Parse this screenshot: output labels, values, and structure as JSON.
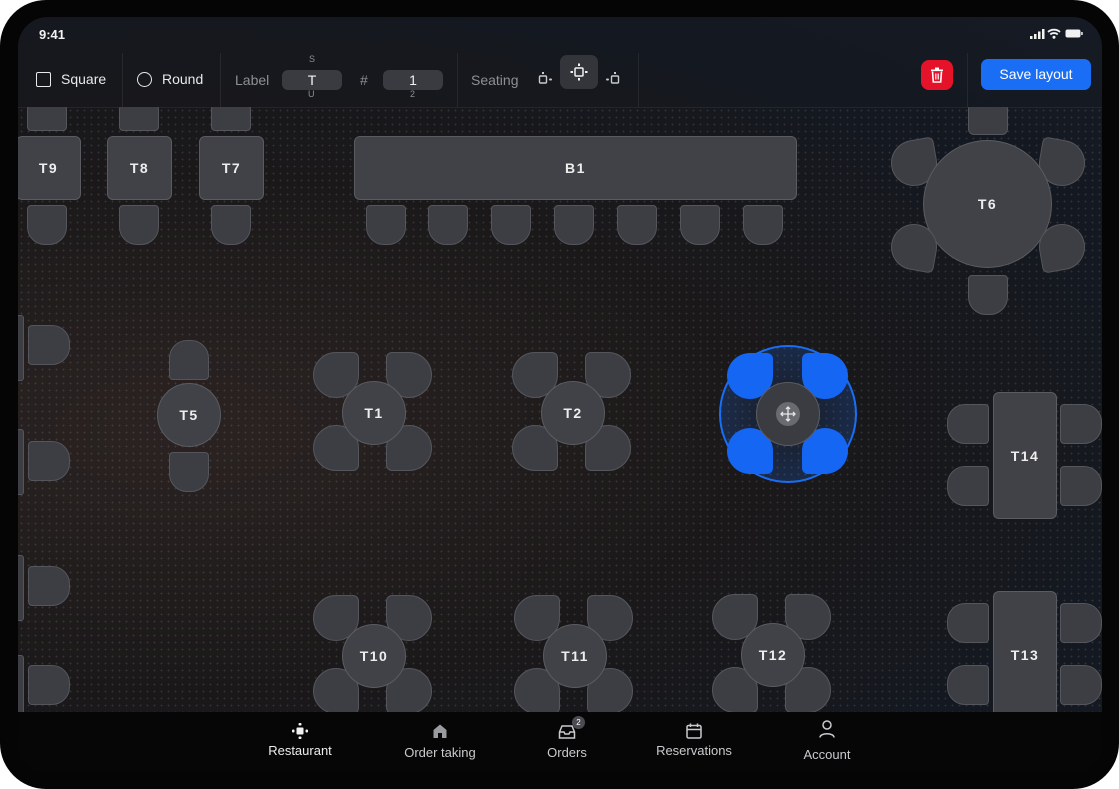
{
  "status_bar": {
    "time": "9:41"
  },
  "toolbar": {
    "square_label": "Square",
    "round_label": "Round",
    "label_field": {
      "label": "Label",
      "value": "T",
      "prev": "S",
      "next": "U"
    },
    "number_field": {
      "label": "#",
      "value": "1",
      "next": "2"
    },
    "seating_label": "Seating",
    "seating_options": [
      "seating-left-icon",
      "seating-all-icon",
      "seating-right-icon"
    ],
    "save_label": "Save layout",
    "delete_color": "#e5132a",
    "accent_color": "#1a6ef5"
  },
  "floor": {
    "tables": [
      {
        "id": "t9",
        "label": "T9"
      },
      {
        "id": "t8",
        "label": "T8"
      },
      {
        "id": "t7",
        "label": "T7"
      },
      {
        "id": "b1",
        "label": "B1"
      },
      {
        "id": "t6",
        "label": "T6"
      },
      {
        "id": "t5",
        "label": "T5"
      },
      {
        "id": "t1",
        "label": "T1"
      },
      {
        "id": "t2",
        "label": "T2"
      },
      {
        "id": "t14",
        "label": "T14"
      },
      {
        "id": "t10",
        "label": "T10"
      },
      {
        "id": "t11",
        "label": "T11"
      },
      {
        "id": "t12",
        "label": "T12"
      },
      {
        "id": "t13",
        "label": "T13"
      }
    ],
    "selected_table_icon": "move-icon"
  },
  "nav": {
    "items": [
      {
        "label": "Restaurant",
        "icon": "restaurant-icon"
      },
      {
        "label": "Order taking",
        "icon": "home-icon"
      },
      {
        "label": "Orders",
        "icon": "tray-icon",
        "badge": "2"
      },
      {
        "label": "Reservations",
        "icon": "calendar-icon"
      },
      {
        "label": "Account",
        "icon": "person-icon"
      }
    ]
  }
}
